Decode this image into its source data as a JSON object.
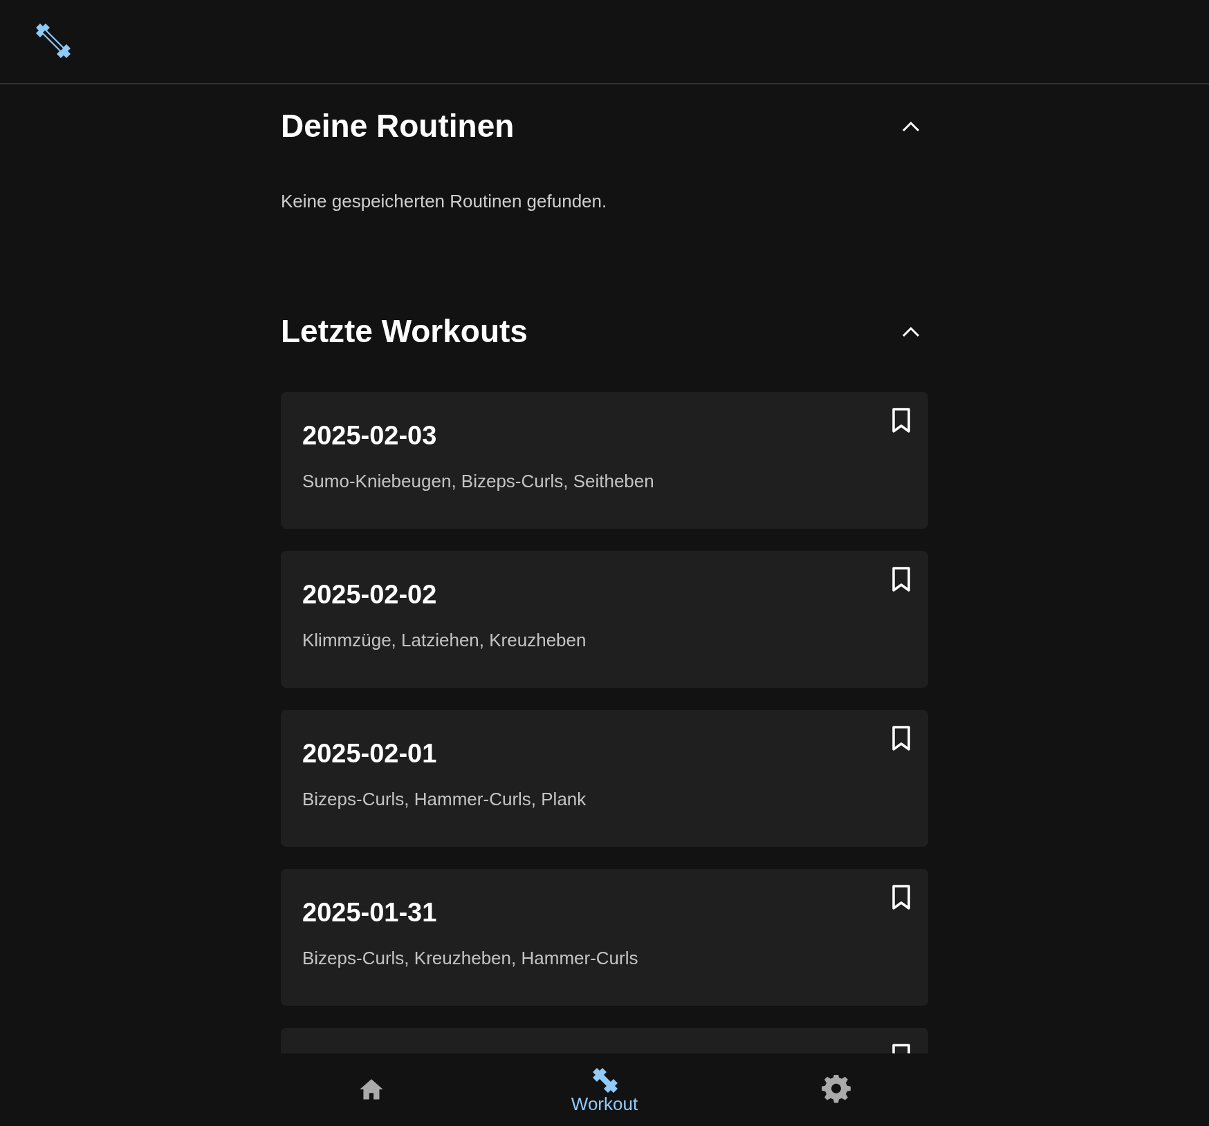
{
  "sections": [
    {
      "title": "Deine Routinen",
      "expanded": true,
      "empty_text": "Keine gespeicherten Routinen gefunden."
    },
    {
      "title": "Letzte Workouts",
      "expanded": true,
      "workouts": [
        {
          "date": "2025-02-03",
          "exercises": "Sumo-Kniebeugen, Bizeps-Curls, Seitheben",
          "saved": false
        },
        {
          "date": "2025-02-02",
          "exercises": "Klimmzüge, Latziehen, Kreuzheben",
          "saved": false
        },
        {
          "date": "2025-02-01",
          "exercises": "Bizeps-Curls, Hammer-Curls, Plank",
          "saved": false
        },
        {
          "date": "2025-01-31",
          "exercises": "Bizeps-Curls, Kreuzheben, Hammer-Curls",
          "saved": false
        },
        {
          "saved": false
        }
      ]
    }
  ],
  "bottom_nav": [
    {
      "kind": "home",
      "selected": false
    },
    {
      "kind": "workout",
      "label": "Workout",
      "selected": true
    },
    {
      "kind": "settings",
      "selected": false
    }
  ]
}
